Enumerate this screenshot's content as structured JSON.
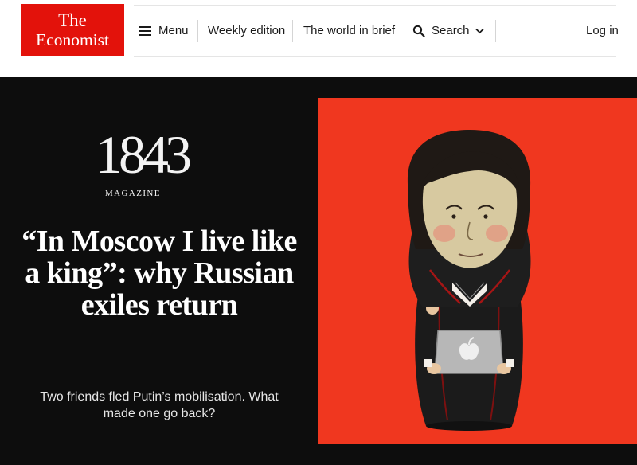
{
  "header": {
    "logo": {
      "line1": "The",
      "line2": "Economist"
    },
    "nav": {
      "menu": "Menu",
      "weekly": "Weekly edition",
      "world": "The world in brief",
      "search": "Search",
      "login": "Log in"
    }
  },
  "hero": {
    "brand": {
      "digits": "1843",
      "label": "MAGAZINE"
    },
    "headline": "“In Moscow I live like a king”: why Russian exiles return",
    "subhead": "Two friends fled Putin’s mobilisation. What made one go back?",
    "illustration": {
      "laptop_logo": ""
    }
  },
  "colors": {
    "brand_red": "#e3120b",
    "hero_background": "#0d0d0d",
    "illustration_background": "#f0371f"
  },
  "icons": [
    "menu-icon",
    "search-icon",
    "chevron-down-icon",
    "apple-logo-icon"
  ]
}
